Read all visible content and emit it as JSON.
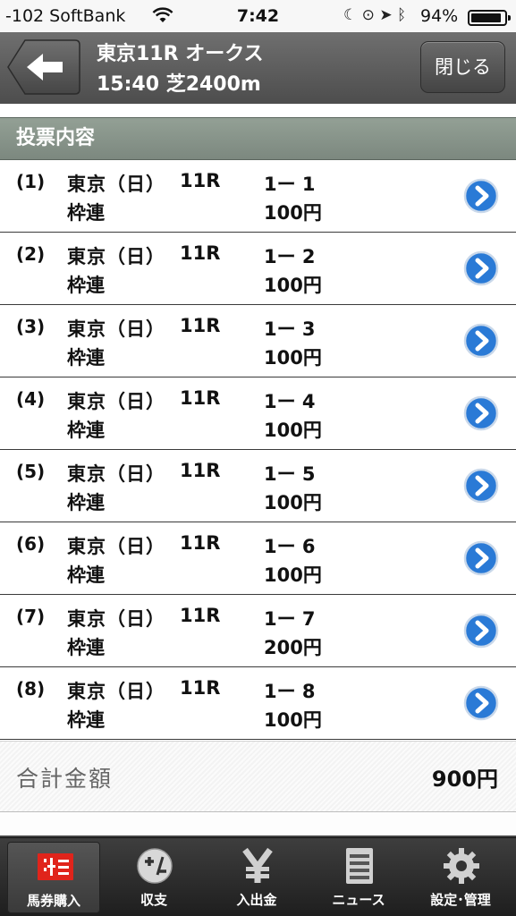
{
  "status_bar": {
    "carrier": "-102 SoftBank",
    "time": "7:42",
    "battery_pct": "94%",
    "battery_level": 0.94
  },
  "header": {
    "title": "東京11R オークス",
    "subtitle": "15:40 芝2400m",
    "close_label": "閉じる"
  },
  "section": {
    "title": "投票内容"
  },
  "bets": [
    {
      "index": "(1)",
      "venue": "東京（日）",
      "race": "11R",
      "combo": "1ー 1",
      "type": "枠連",
      "amount": "100円"
    },
    {
      "index": "(2)",
      "venue": "東京（日）",
      "race": "11R",
      "combo": "1ー 2",
      "type": "枠連",
      "amount": "100円"
    },
    {
      "index": "(3)",
      "venue": "東京（日）",
      "race": "11R",
      "combo": "1ー 3",
      "type": "枠連",
      "amount": "100円"
    },
    {
      "index": "(4)",
      "venue": "東京（日）",
      "race": "11R",
      "combo": "1ー 4",
      "type": "枠連",
      "amount": "100円"
    },
    {
      "index": "(5)",
      "venue": "東京（日）",
      "race": "11R",
      "combo": "1ー 5",
      "type": "枠連",
      "amount": "100円"
    },
    {
      "index": "(6)",
      "venue": "東京（日）",
      "race": "11R",
      "combo": "1ー 6",
      "type": "枠連",
      "amount": "100円"
    },
    {
      "index": "(7)",
      "venue": "東京（日）",
      "race": "11R",
      "combo": "1ー 7",
      "type": "枠連",
      "amount": "200円"
    },
    {
      "index": "(8)",
      "venue": "東京（日）",
      "race": "11R",
      "combo": "1ー 8",
      "type": "枠連",
      "amount": "100円"
    }
  ],
  "total": {
    "label": "合計金額",
    "value": "900円"
  },
  "tabs": [
    {
      "label": "馬券購入",
      "icon": "ticket-icon",
      "active": true
    },
    {
      "label": "収支",
      "icon": "plus-minus-icon",
      "active": false
    },
    {
      "label": "入出金",
      "icon": "yen-icon",
      "active": false
    },
    {
      "label": "ニュース",
      "icon": "news-icon",
      "active": false
    },
    {
      "label": "設定･管理",
      "icon": "gear-icon",
      "active": false
    }
  ],
  "colors": {
    "header": "#5a5a5a",
    "section": "#879489",
    "chevron": "#2a7ad6",
    "tab_active_icon": "#e0241b"
  }
}
